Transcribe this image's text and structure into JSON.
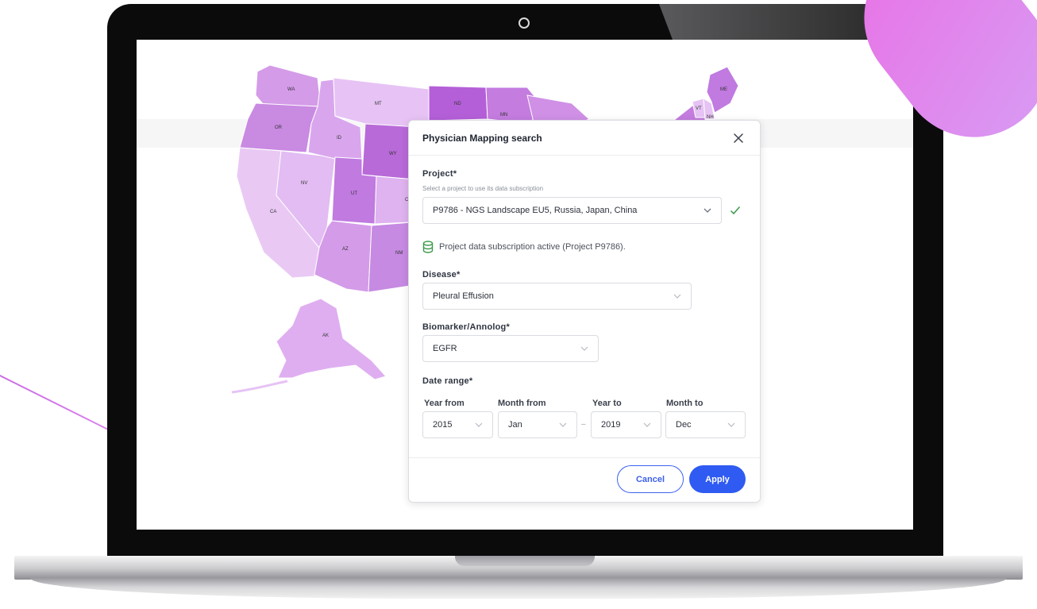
{
  "colors": {
    "accent": "#2f5bf2",
    "success": "#3a9a4a",
    "map_light": "#e9c9f4",
    "map_mid": "#d49be8",
    "map_dark": "#b45fd8"
  },
  "map": {
    "states": [
      "WA",
      "OR",
      "CA",
      "MT",
      "ID",
      "NV",
      "WY",
      "UT",
      "AZ",
      "NM",
      "ND",
      "MN",
      "ME",
      "VT",
      "NH",
      "AK",
      "C"
    ]
  },
  "modal": {
    "title": "Physician Mapping search",
    "close_icon": "close-icon",
    "project": {
      "label": "Project*",
      "help": "Select a project to use its data subscription",
      "value": "P9786 - NGS Landscape EU5, Russia, Japan, China",
      "valid_icon": "check-icon"
    },
    "subscription_status": {
      "icon": "database-icon",
      "text": "Project data subscription active (Project P9786)."
    },
    "disease": {
      "label": "Disease*",
      "value": "Pleural Effusion"
    },
    "biomarker": {
      "label": "Biomarker/Annolog*",
      "value": "EGFR"
    },
    "date_range": {
      "label": "Date range*",
      "year_from": {
        "label": "Year from",
        "value": "2015"
      },
      "month_from": {
        "label": "Month from",
        "value": "Jan"
      },
      "year_to": {
        "label": "Year to",
        "value": "2019"
      },
      "month_to": {
        "label": "Month to",
        "value": "Dec"
      },
      "separator": "–"
    },
    "buttons": {
      "cancel": "Cancel",
      "apply": "Apply"
    }
  }
}
